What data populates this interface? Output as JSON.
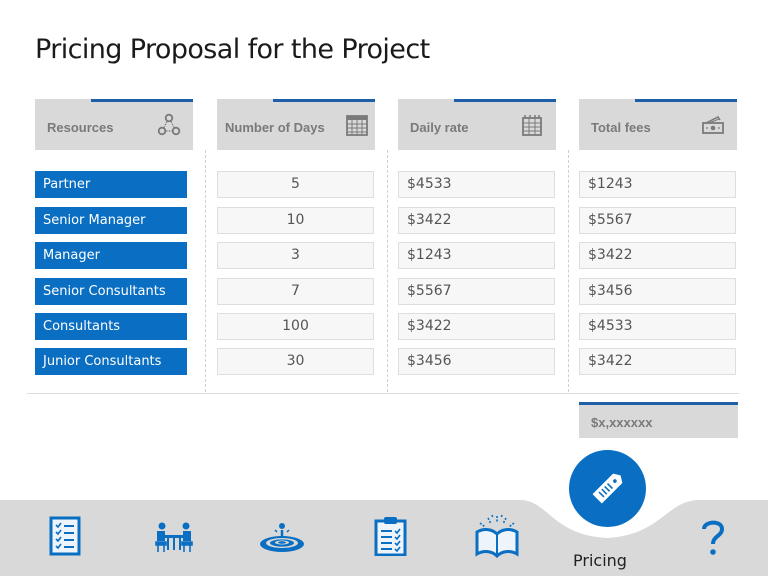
{
  "title": "Pricing Proposal for the Project",
  "columns": [
    {
      "label": "Resources",
      "icon": "people-network-icon"
    },
    {
      "label": "Number of Days",
      "icon": "calendar-icon"
    },
    {
      "label": "Daily rate",
      "icon": "calendar-table-icon"
    },
    {
      "label": "Total fees",
      "icon": "money-icon"
    }
  ],
  "rows": [
    {
      "resource": "Partner",
      "days": "5",
      "daily_rate": "$4533",
      "total_fees": "$1243"
    },
    {
      "resource": "Senior Manager",
      "days": "10",
      "daily_rate": "$3422",
      "total_fees": "$5567"
    },
    {
      "resource": "Manager",
      "days": "3",
      "daily_rate": "$1243",
      "total_fees": "$3422"
    },
    {
      "resource": "Senior Consultants",
      "days": "7",
      "daily_rate": "$5567",
      "total_fees": "$3456"
    },
    {
      "resource": "Consultants",
      "days": "100",
      "daily_rate": "$3422",
      "total_fees": "$4533"
    },
    {
      "resource": "Junior Consultants",
      "days": "30",
      "daily_rate": "$3456",
      "total_fees": "$3422"
    }
  ],
  "total": "$x,xxxxxx",
  "nav": {
    "items": [
      {
        "name": "checklist",
        "icon": "checklist-icon"
      },
      {
        "name": "meeting",
        "icon": "meeting-icon"
      },
      {
        "name": "impact",
        "icon": "water-drop-ripple-icon"
      },
      {
        "name": "clipboard",
        "icon": "clipboard-icon"
      },
      {
        "name": "learning",
        "icon": "open-book-icon"
      },
      {
        "name": "help",
        "icon": "question-mark-icon"
      }
    ],
    "active_label": "Pricing",
    "active_icon": "price-tag-icon"
  },
  "colors": {
    "accent_blue": "#0a6fc2",
    "header_line": "#1f5fa8",
    "header_bg": "#d9d9d9",
    "nav_bg": "#d9d9d9"
  }
}
